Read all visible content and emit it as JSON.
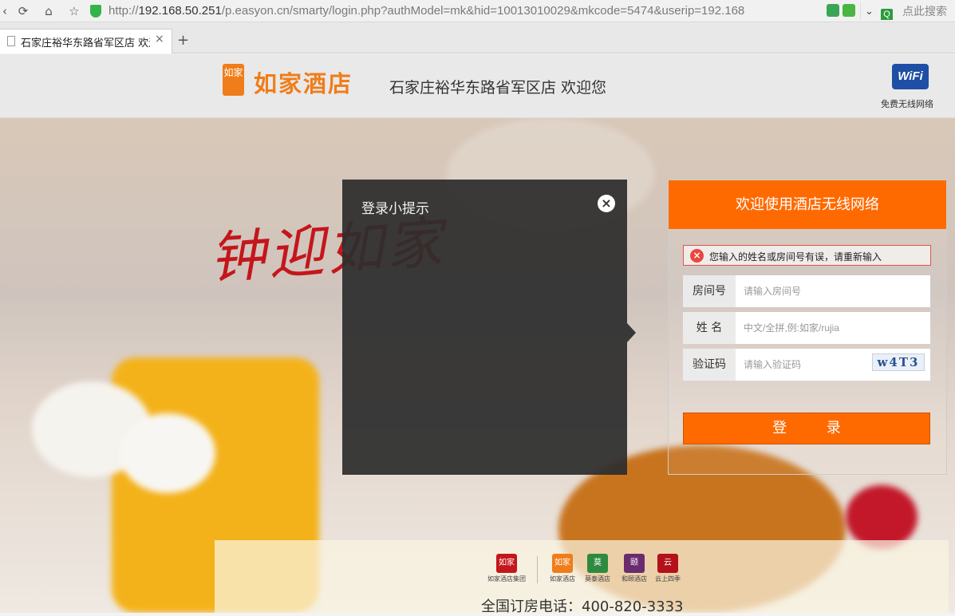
{
  "browser": {
    "url_scheme": "http://",
    "url_host": "192.168.50.251",
    "url_path": "/p.easyon.cn/smarty/login.php?authModel=mk&hid=10013010029&mkcode=5474&userip=192.168",
    "search_placeholder": "点此搜索",
    "tab_title": "石家庄裕华东路省军区店 欢迎",
    "tab_close": "×",
    "new_tab": "+"
  },
  "header": {
    "brand_name": "如家酒店",
    "seal_text": "如家",
    "welcome": "石家庄裕华东路省军区店 欢迎您",
    "wifi_badge": "WiFi",
    "wifi_label": "免费无线网络"
  },
  "hero": {
    "script_text": "钟迎如家"
  },
  "tip_modal": {
    "title": "登录小提示",
    "close": "×"
  },
  "login": {
    "title": "欢迎使用酒店无线网络",
    "error_message": "您输入的姓名或房间号有误，请重新输入",
    "room_label": "房间号",
    "room_placeholder": "请输入房间号",
    "name_label": "姓 名",
    "name_placeholder": "中文/全拼,例:如家/rujia",
    "captcha_label": "验证码",
    "captcha_placeholder": "请输入验证码",
    "captcha_value": "w4T3",
    "submit": "登 录"
  },
  "footer": {
    "brands": [
      {
        "name": "如家酒店集团",
        "glyph": "如家",
        "color": "#c4161c"
      },
      {
        "name": "如家酒店",
        "glyph": "如家",
        "color": "#ef7d1a"
      },
      {
        "name": "莫泰酒店",
        "glyph": "莫",
        "color": "#2d8a3e"
      },
      {
        "name": "和颐酒店",
        "glyph": "颐",
        "color": "#6a2c6e"
      },
      {
        "name": "云上四季",
        "glyph": "云",
        "color": "#b3121a"
      }
    ],
    "phone": "全国订房电话：400-820-3333"
  },
  "colors": {
    "accent": "#ff6a00",
    "brand_orange": "#ef7d1a",
    "error_red": "#e9473f"
  }
}
